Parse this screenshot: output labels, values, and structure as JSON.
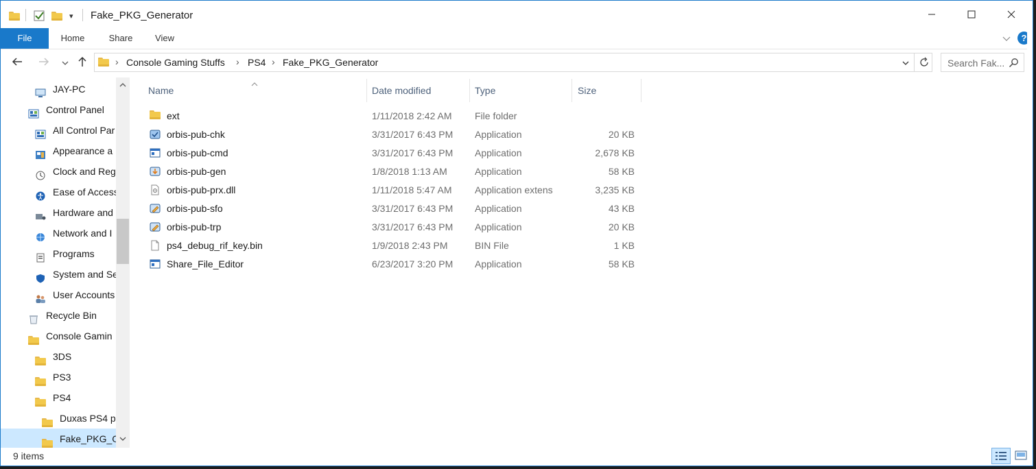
{
  "window": {
    "title": "Fake_PKG_Generator",
    "qa_dropdown_glyph": "▾"
  },
  "ribbon": {
    "tabs": [
      "File",
      "Home",
      "Share",
      "View"
    ]
  },
  "address": {
    "crumbs": [
      "Console Gaming Stuffs",
      "PS4",
      "Fake_PKG_Generator"
    ],
    "search_placeholder": "Search Fak..."
  },
  "nav_pane": {
    "items": [
      {
        "label": "JAY-PC",
        "icon": "computer-icon",
        "indent": 2
      },
      {
        "label": "Control Panel",
        "icon": "control-panel-icon",
        "indent": 1
      },
      {
        "label": "All Control Par",
        "icon": "control-panel-icon",
        "indent": 2
      },
      {
        "label": "Appearance a",
        "icon": "appearance-icon",
        "indent": 2
      },
      {
        "label": "Clock and Reg",
        "icon": "clock-icon",
        "indent": 2
      },
      {
        "label": "Ease of Access",
        "icon": "ease-of-access-icon",
        "indent": 2
      },
      {
        "label": "Hardware and",
        "icon": "hardware-icon",
        "indent": 2
      },
      {
        "label": "Network and I",
        "icon": "network-icon",
        "indent": 2
      },
      {
        "label": "Programs",
        "icon": "programs-icon",
        "indent": 2
      },
      {
        "label": "System and Se",
        "icon": "shield-icon",
        "indent": 2
      },
      {
        "label": "User Accounts",
        "icon": "users-icon",
        "indent": 2
      },
      {
        "label": "Recycle Bin",
        "icon": "recycle-bin-icon",
        "indent": 1
      },
      {
        "label": "Console Gamin",
        "icon": "folder-icon",
        "indent": 1
      },
      {
        "label": "3DS",
        "icon": "folder-icon",
        "indent": 2
      },
      {
        "label": "PS3",
        "icon": "folder-icon",
        "indent": 2
      },
      {
        "label": "PS4",
        "icon": "folder-icon",
        "indent": 2
      },
      {
        "label": "Duxas PS4 p",
        "icon": "folder-icon",
        "indent": 3
      },
      {
        "label": "Fake_PKG_Ge",
        "icon": "folder-icon",
        "indent": 3,
        "selected": true
      }
    ]
  },
  "file_list": {
    "columns": [
      "Name",
      "Date modified",
      "Type",
      "Size"
    ],
    "rows": [
      {
        "name": "ext",
        "date": "1/11/2018 2:42 AM",
        "type": "File folder",
        "size": "",
        "icon": "folder-icon"
      },
      {
        "name": "orbis-pub-chk",
        "date": "3/31/2017 6:43 PM",
        "type": "Application",
        "size": "20 KB",
        "icon": "app-chk-icon"
      },
      {
        "name": "orbis-pub-cmd",
        "date": "3/31/2017 6:43 PM",
        "type": "Application",
        "size": "2,678 KB",
        "icon": "app-window-icon"
      },
      {
        "name": "orbis-pub-gen",
        "date": "1/8/2018 1:13 AM",
        "type": "Application",
        "size": "58 KB",
        "icon": "app-gen-icon"
      },
      {
        "name": "orbis-pub-prx.dll",
        "date": "1/11/2018 5:47 AM",
        "type": "Application extens",
        "size": "3,235 KB",
        "icon": "dll-icon"
      },
      {
        "name": "orbis-pub-sfo",
        "date": "3/31/2017 6:43 PM",
        "type": "Application",
        "size": "43 KB",
        "icon": "app-edit-icon"
      },
      {
        "name": "orbis-pub-trp",
        "date": "3/31/2017 6:43 PM",
        "type": "Application",
        "size": "20 KB",
        "icon": "app-edit-icon"
      },
      {
        "name": "ps4_debug_rif_key.bin",
        "date": "1/9/2018 2:43 PM",
        "type": "BIN File",
        "size": "1 KB",
        "icon": "file-icon"
      },
      {
        "name": "Share_File_Editor",
        "date": "6/23/2017 3:20 PM",
        "type": "Application",
        "size": "58 KB",
        "icon": "app-window-icon"
      }
    ]
  },
  "status": {
    "item_count": "9 items"
  },
  "colors": {
    "accent": "#1979ca",
    "folder": "#f2c94c",
    "selection": "#cce8ff"
  }
}
